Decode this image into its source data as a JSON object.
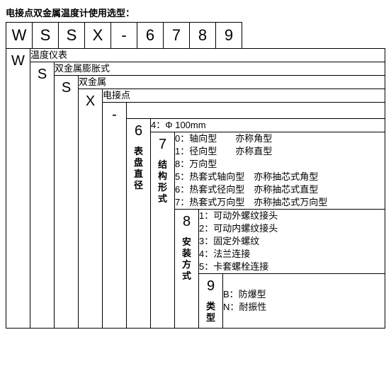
{
  "title": "电接点双金属温度计使用选型：",
  "code": {
    "c1": "W",
    "c2": "S",
    "c3": "S",
    "c4": "X",
    "c5": "-",
    "c6": "6",
    "c7": "7",
    "c8": "8",
    "c9": "9"
  },
  "rows": {
    "r1": {
      "code": "W",
      "desc": "温度仪表"
    },
    "r2": {
      "code": "S",
      "desc": "双金属膨胀式"
    },
    "r3": {
      "code": "S",
      "desc": "双金属"
    },
    "r4": {
      "code": "X",
      "desc": "电接点"
    },
    "r5": {
      "code": "-",
      "desc": ""
    },
    "r6": {
      "code": "6",
      "vlabel": "表盘直径",
      "desc_line1": "4：Φ 100mm"
    },
    "r7": {
      "code": "7",
      "vlabel": "结构形式",
      "l1": "0：轴向型　　亦称角型",
      "l2": "1：径向型　　亦称直型",
      "l3": "8：万向型",
      "l4": "5：热套式轴向型　亦称抽芯式角型",
      "l5": "6：热套式径向型　亦称抽芯式直型",
      "l6": "7：热套式万向型　亦称抽芯式万向型"
    },
    "r8": {
      "code": "8",
      "vlabel": "安装方式",
      "l1": "1：可动外螺纹接头",
      "l2": "2：可动内螺纹接头",
      "l3": "3：固定外螺纹",
      "l4": "4：法兰连接",
      "l5": "5：卡套螺栓连接"
    },
    "r9": {
      "code": "9",
      "vlabel": "类型",
      "l1": "B：防爆型",
      "l2": "N：耐振性"
    }
  },
  "chart_data": {
    "type": "table",
    "title": "电接点双金属温度计使用选型",
    "model_code": "WSSX-6789",
    "positions": [
      {
        "pos": 1,
        "symbol": "W",
        "meaning": "温度仪表"
      },
      {
        "pos": 2,
        "symbol": "S",
        "meaning": "双金属膨胀式"
      },
      {
        "pos": 3,
        "symbol": "S",
        "meaning": "双金属"
      },
      {
        "pos": 4,
        "symbol": "X",
        "meaning": "电接点"
      },
      {
        "pos": 5,
        "symbol": "-",
        "meaning": ""
      },
      {
        "pos": 6,
        "symbol": "6",
        "category": "表盘直径",
        "options": [
          {
            "code": "4",
            "desc": "Φ 100mm"
          }
        ]
      },
      {
        "pos": 7,
        "symbol": "7",
        "category": "结构形式",
        "options": [
          {
            "code": "0",
            "desc": "轴向型 亦称角型"
          },
          {
            "code": "1",
            "desc": "径向型 亦称直型"
          },
          {
            "code": "8",
            "desc": "万向型"
          },
          {
            "code": "5",
            "desc": "热套式轴向型 亦称抽芯式角型"
          },
          {
            "code": "6",
            "desc": "热套式径向型 亦称抽芯式直型"
          },
          {
            "code": "7",
            "desc": "热套式万向型 亦称抽芯式万向型"
          }
        ]
      },
      {
        "pos": 8,
        "symbol": "8",
        "category": "安装方式",
        "options": [
          {
            "code": "1",
            "desc": "可动外螺纹接头"
          },
          {
            "code": "2",
            "desc": "可动内螺纹接头"
          },
          {
            "code": "3",
            "desc": "固定外螺纹"
          },
          {
            "code": "4",
            "desc": "法兰连接"
          },
          {
            "code": "5",
            "desc": "卡套螺栓连接"
          }
        ]
      },
      {
        "pos": 9,
        "symbol": "9",
        "category": "类型",
        "options": [
          {
            "code": "B",
            "desc": "防爆型"
          },
          {
            "code": "N",
            "desc": "耐振性"
          }
        ]
      }
    ]
  }
}
